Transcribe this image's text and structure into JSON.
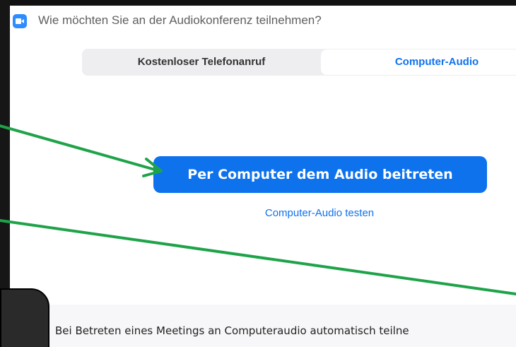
{
  "window": {
    "title": "Wie möchten Sie an der Audiokonferenz teilnehmen?",
    "app_icon": "zoom-camera-icon"
  },
  "tabs": [
    {
      "label": "Kostenloser Telefonanruf",
      "selected": false
    },
    {
      "label": "Computer-Audio",
      "selected": true
    }
  ],
  "main": {
    "join_button_label": "Per Computer dem Audio beitreten",
    "test_link_label": "Computer-Audio testen"
  },
  "footer": {
    "auto_join_text": "Bei Betreten eines Meetings an Computeraudio automatisch teilne"
  },
  "colors": {
    "accent": "#0e72ed",
    "annotation_arrow": "#1fa34a",
    "tab_bar_bg": "#eeeef1"
  }
}
